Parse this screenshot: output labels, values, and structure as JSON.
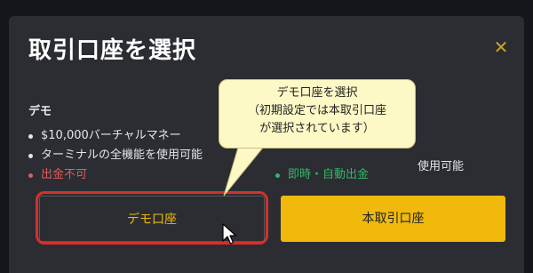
{
  "dialog": {
    "title": "取引口座を選択",
    "close_icon": "close-icon",
    "demo_heading": "デモ",
    "demo_features": [
      "$10,000バーチャルマネー",
      "ターミナルの全機能を使用可能",
      "出金不可"
    ],
    "real_features": [
      "",
      "",
      "即時・自動出金"
    ],
    "real_partial_text": "使用可能",
    "demo_button_label": "デモ口座",
    "real_button_label": "本取引口座"
  },
  "callout": {
    "lines": [
      "デモ口座を選択",
      "（初期設定では本取引口座",
      "が選択されています）"
    ]
  },
  "colors": {
    "accent": "#f0b90b",
    "negative": "#e05d5d",
    "positive": "#33b866",
    "highlight": "#d4312a",
    "callout_bg": "#fdf9c6"
  }
}
